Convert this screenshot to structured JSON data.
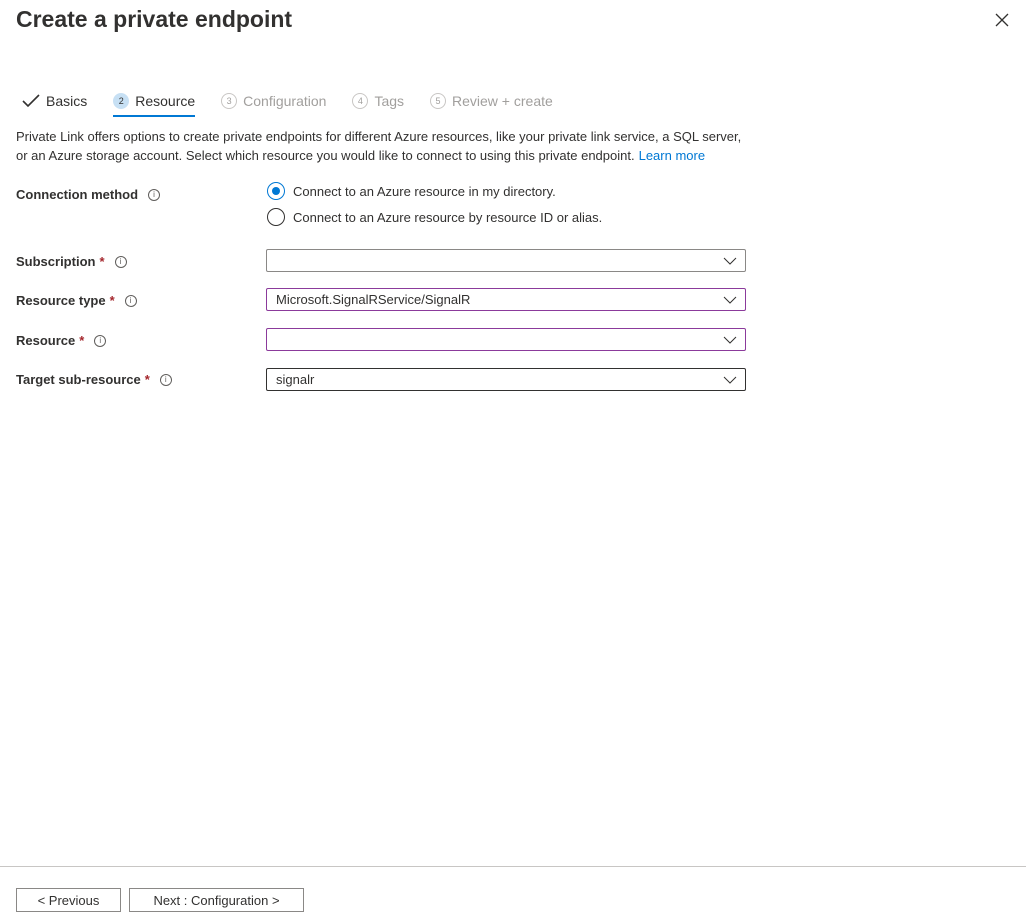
{
  "title": "Create a private endpoint",
  "tabs": [
    {
      "label": "Basics",
      "state": "done"
    },
    {
      "num": "2",
      "label": "Resource",
      "state": "active"
    },
    {
      "num": "3",
      "label": "Configuration",
      "state": "disabled"
    },
    {
      "num": "4",
      "label": "Tags",
      "state": "disabled"
    },
    {
      "num": "5",
      "label": "Review + create",
      "state": "disabled"
    }
  ],
  "description": "Private Link offers options to create private endpoints for different Azure resources, like your private link service, a SQL server, or an Azure storage account. Select which resource you would like to connect to using this private endpoint.",
  "learn_more": "Learn more",
  "connection_method": {
    "label": "Connection method",
    "options": [
      "Connect to an Azure resource in my directory.",
      "Connect to an Azure resource by resource ID or alias."
    ],
    "selected": 0
  },
  "fields": {
    "subscription": {
      "label": "Subscription",
      "value": ""
    },
    "resource_type": {
      "label": "Resource type",
      "value": "Microsoft.SignalRService/SignalR"
    },
    "resource": {
      "label": "Resource",
      "value": ""
    },
    "target_sub_resource": {
      "label": "Target sub-resource",
      "value": "signalr"
    }
  },
  "required_mark": "*",
  "info_glyph": "i",
  "footer": {
    "previous": "< Previous",
    "next": "Next : Configuration >"
  }
}
